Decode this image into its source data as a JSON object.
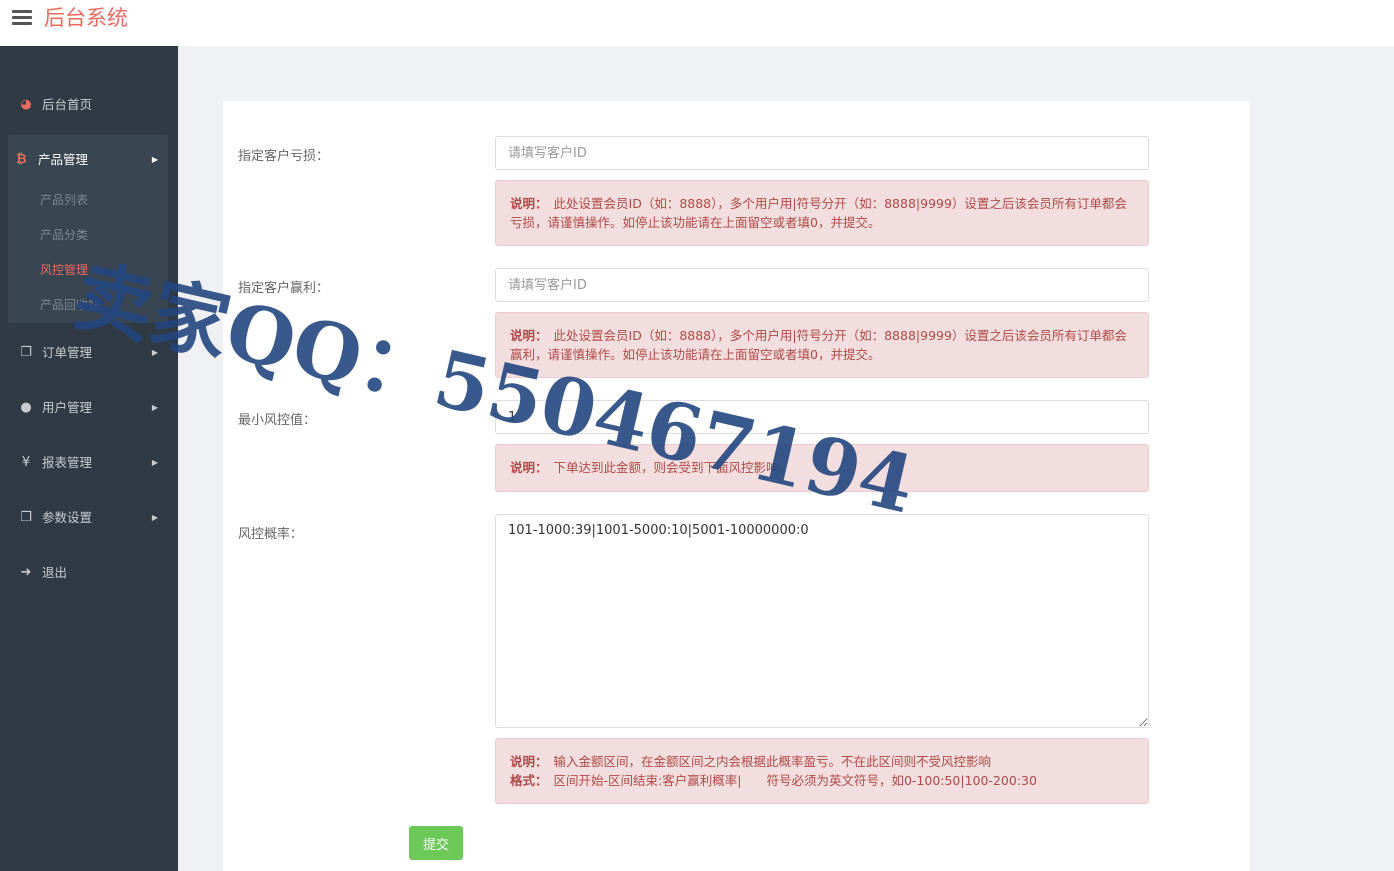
{
  "header": {
    "title": "后台系统"
  },
  "sidebar": {
    "home": "后台首页",
    "product_group": {
      "label": "产品管理",
      "items": [
        "产品列表",
        "产品分类",
        "风控管理",
        "产品回收站"
      ],
      "active": "风控管理"
    },
    "orders": "订单管理",
    "users": "用户管理",
    "reports": "报表管理",
    "settings": "参数设置",
    "logout": "退出"
  },
  "form": {
    "loss": {
      "label": "指定客户亏损：",
      "placeholder": "请填写客户ID",
      "value": "",
      "note_label": "说明：",
      "note": "此处设置会员ID（如：8888），多个用户用|符号分开（如：8888|9999）设置之后该会员所有订单都会亏损，请谨慎操作。如停止该功能请在上面留空或者填0，并提交。"
    },
    "profit": {
      "label": "指定客户赢利：",
      "placeholder": "请填写客户ID",
      "value": "",
      "note_label": "说明：",
      "note": "此处设置会员ID（如：8888），多个用户用|符号分开（如：8888|9999）设置之后该会员所有订单都会赢利，请谨慎操作。如停止该功能请在上面留空或者填0，并提交。"
    },
    "min_risk": {
      "label": "最小风控值：",
      "value": "1",
      "note_label": "说明：",
      "note": "下单达到此金额，则会受到下面风控影响。"
    },
    "risk_rate": {
      "label": "风控概率：",
      "value": "101-1000:39|1001-5000:10|5001-10000000:0",
      "note_label": "说明：",
      "note": "输入金额区间，在金额区间之内会根据此概率盈亏。不在此区间则不受风控影响",
      "format_label": "格式：",
      "format": "区间开始-区间结束:客户赢利概率|　　符号必须为英文符号，如0-100:50|100-200:30"
    },
    "submit": "提交"
  },
  "watermark": "卖家QQ：550467194",
  "colors": {
    "brand": "#ea6b5f",
    "sidebar": "#2f3a44",
    "submit": "#6cc957",
    "note_bg": "#f2dede",
    "note_text": "#b04a48"
  }
}
